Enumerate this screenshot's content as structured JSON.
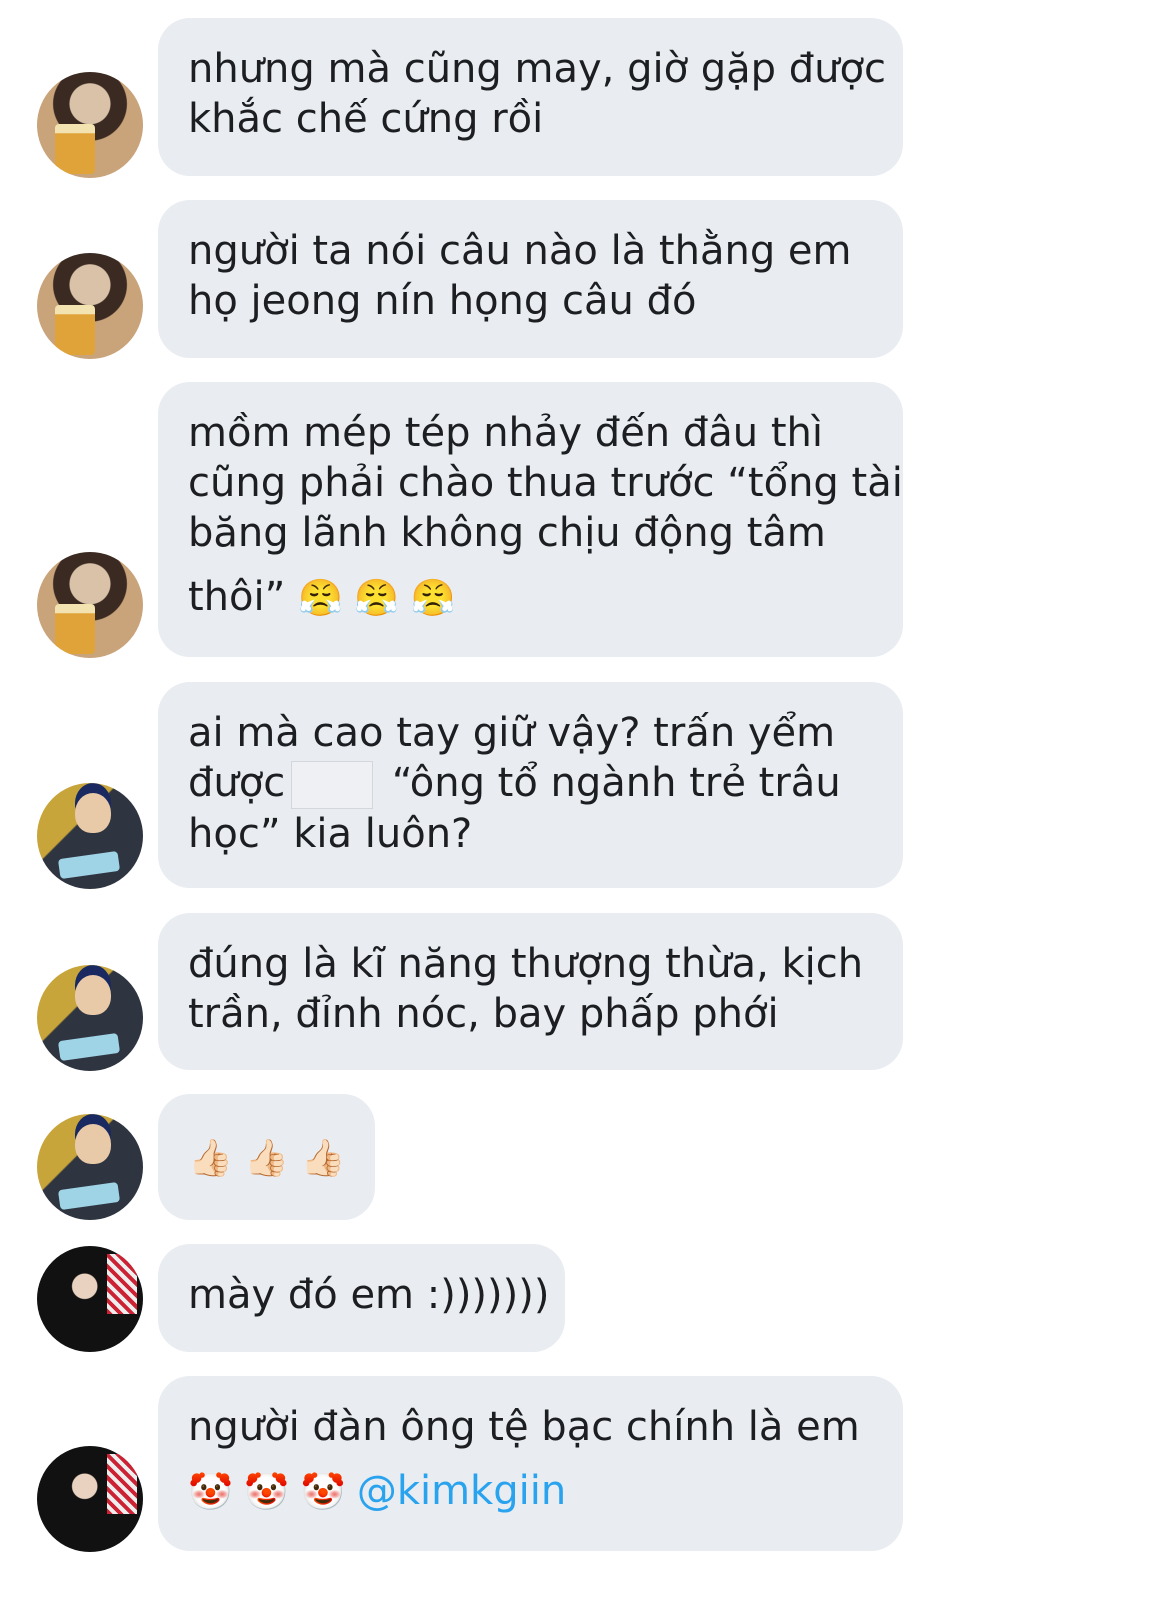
{
  "messages": [
    {
      "avatar": "beer-avatar",
      "lines": [
        "nhưng mà cũng may, giờ gặp được",
        "khắc chế cứng rồi"
      ]
    },
    {
      "avatar": "beer-avatar",
      "lines": [
        "người ta nói câu nào là thằng em",
        "họ jeong nín họng câu đó"
      ]
    },
    {
      "avatar": "beer-avatar",
      "lines": [
        "mồm mép tép nhảy đến đâu thì",
        "cũng phải chào thua trước “tổng tài",
        "băng lãnh không chịu động tâm",
        "thôi” "
      ],
      "emojis": "😤 😤 😤"
    },
    {
      "avatar": "cap-avatar",
      "lines": [
        "ai mà cao tay giữ vậy? trấn yểm",
        "được",
        " “ông tổ ngành trẻ trâu",
        "học” kia luôn?"
      ]
    },
    {
      "avatar": "cap-avatar",
      "lines": [
        "đúng là kĩ năng thượng thừa, kịch",
        "trần, đỉnh nóc, bay phấp phới"
      ]
    },
    {
      "avatar": "cap-avatar",
      "emojis": "👍🏻 👍🏻 👍🏻"
    },
    {
      "avatar": "suit-avatar",
      "lines": [
        "mày đó em :)))))))"
      ]
    },
    {
      "avatar": "suit-avatar",
      "lines": [
        "người đàn ông tệ bạc chính là em"
      ],
      "emojis": "🤡 🤡 🤡 ",
      "mention": "@kimkgiin"
    }
  ]
}
